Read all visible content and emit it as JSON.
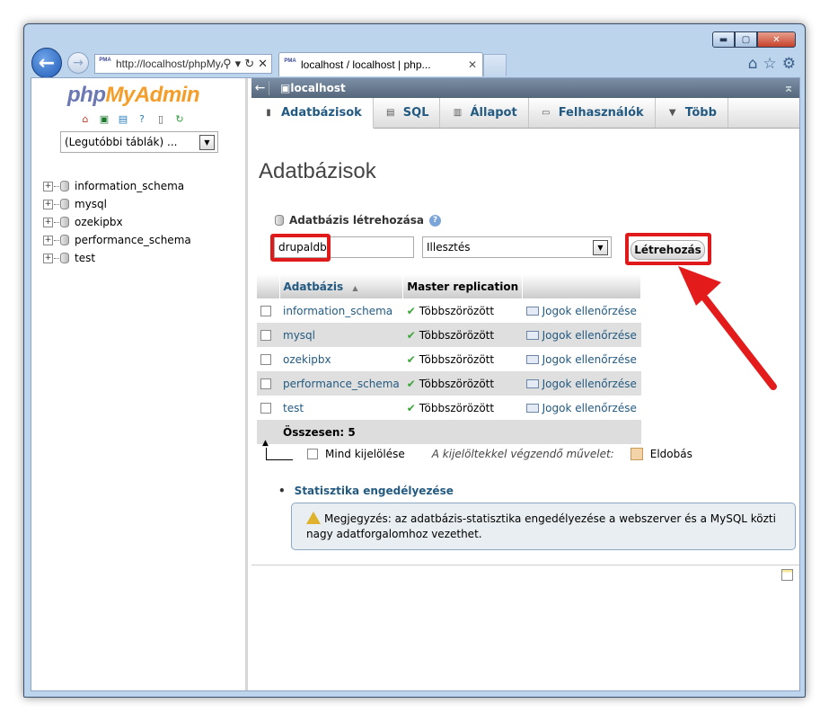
{
  "browser": {
    "address": "http://localhost/phpMyAdmin",
    "tab_title": "localhost / localhost | php...",
    "favicon_text": "PMA",
    "window_buttons": [
      "minimize-icon",
      "maximize-icon",
      "close-icon"
    ],
    "toolbar_icons": [
      "home-icon",
      "star-icon",
      "gear-icon"
    ]
  },
  "sidebar": {
    "logo_php": "php",
    "logo_ma": "MyAdmin",
    "recent_tables": "(Legutóbbi táblák) ...",
    "databases": [
      "information_schema",
      "mysql",
      "ozekipbx",
      "performance_schema",
      "test"
    ]
  },
  "header": {
    "server": "localhost",
    "tabs": [
      "Adatbázisok",
      "SQL",
      "Állapot",
      "Felhasználók",
      "Több"
    ]
  },
  "main": {
    "title": "Adatbázisok",
    "create_label": "Adatbázis létrehozása",
    "db_name_value": "drupaldb",
    "collation": "Illesztés",
    "create_button": "Létrehozás",
    "table": {
      "col_db": "Adatbázis",
      "col_replication": "Master replication",
      "sort_indicator": "▲",
      "rows": [
        {
          "name": "information_schema",
          "replication": "Többszörözött",
          "priv": "Jogok ellenőrzése"
        },
        {
          "name": "mysql",
          "replication": "Többszörözött",
          "priv": "Jogok ellenőrzése"
        },
        {
          "name": "ozekipbx",
          "replication": "Többszörözött",
          "priv": "Jogok ellenőrzése"
        },
        {
          "name": "performance_schema",
          "replication": "Többszörözött",
          "priv": "Jogok ellenőrzése"
        },
        {
          "name": "test",
          "replication": "Többszörözött",
          "priv": "Jogok ellenőrzése"
        }
      ],
      "total": "Összesen: 5"
    },
    "select_all": "Mind kijelölése",
    "with_selected": "A kijelöltekkel végzendő művelet:",
    "drop": "Eldobás",
    "stats_link": "Statisztika engedélyezése",
    "note": "Megjegyzés: az adatbázis-statisztika engedélyezése a webszerver és a MySQL közti nagy adatforgalomhoz vezethet."
  }
}
